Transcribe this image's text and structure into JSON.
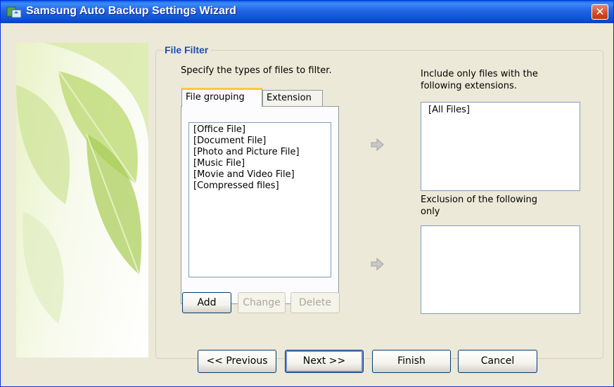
{
  "window": {
    "title": "Samsung Auto Backup Settings Wizard"
  },
  "filter": {
    "group_title": "File Filter",
    "instruction": "Specify the types of files to filter.",
    "tabs": [
      "File grouping",
      "Extension"
    ],
    "groups": [
      "[Office File]",
      "[Document File]",
      "[Photo and Picture File]",
      "[Music File]",
      "[Movie and Video File]",
      "[Compressed files]"
    ],
    "add_label": "Add",
    "change_label": "Change",
    "delete_label": "Delete"
  },
  "include": {
    "label_line1": "Include only files with the",
    "label_line2": "following extensions.",
    "items": [
      "[All Files]"
    ]
  },
  "exclude": {
    "label_line1": "Exclusion of the following",
    "label_line2": "only",
    "items": []
  },
  "footer": {
    "previous_label": "<< Previous",
    "next_label": "Next >>",
    "finish_label": "Finish",
    "cancel_label": "Cancel"
  },
  "colors": {
    "title_bar": "#2667e8",
    "group_title": "#1c4fb0",
    "tab_highlight": "#ffc83c"
  },
  "icons": {
    "app": "backup-app-icon",
    "close": "close-icon",
    "arrow": "right-arrow-icon"
  }
}
